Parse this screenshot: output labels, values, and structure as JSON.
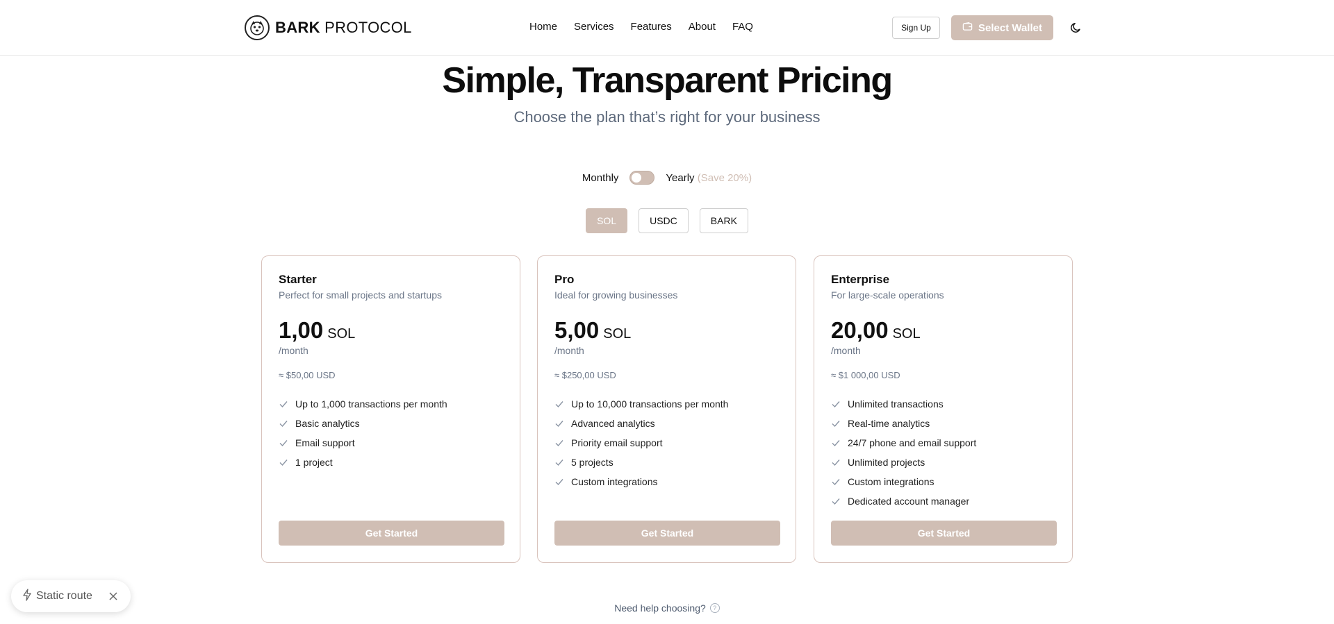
{
  "header": {
    "logo_bold": "BARK",
    "logo_rest": " PROTOCOL",
    "nav": [
      "Home",
      "Services",
      "Features",
      "About",
      "FAQ"
    ],
    "signup_label": "Sign Up",
    "wallet_label": "Select Wallet"
  },
  "hero": {
    "title": "Simple, Transparent Pricing",
    "subtitle": "Choose the plan that’s right for your business"
  },
  "billing": {
    "monthly_label": "Monthly",
    "yearly_label": "Yearly",
    "save_label": "(Save 20%)"
  },
  "currencies": [
    "SOL",
    "USDC",
    "BARK"
  ],
  "plans": [
    {
      "name": "Starter",
      "description": "Perfect for small projects and startups",
      "price": "1,00",
      "currency": "SOL",
      "period": "/month",
      "usd": "≈ $50,00 USD",
      "features": [
        "Up to 1,000 transactions per month",
        "Basic analytics",
        "Email support",
        "1 project"
      ],
      "cta": "Get Started"
    },
    {
      "name": "Pro",
      "description": "Ideal for growing businesses",
      "price": "5,00",
      "currency": "SOL",
      "period": "/month",
      "usd": "≈ $250,00 USD",
      "features": [
        "Up to 10,000 transactions per month",
        "Advanced analytics",
        "Priority email support",
        "5 projects",
        "Custom integrations"
      ],
      "cta": "Get Started"
    },
    {
      "name": "Enterprise",
      "description": "For large-scale operations",
      "price": "20,00",
      "currency": "SOL",
      "period": "/month",
      "usd": "≈ $1 000,00 USD",
      "features": [
        "Unlimited transactions",
        "Real-time analytics",
        "24/7 phone and email support",
        "Unlimited projects",
        "Custom integrations",
        "Dedicated account manager"
      ],
      "cta": "Get Started"
    }
  ],
  "help": {
    "label": "Need help choosing?",
    "icon_glyph": "?"
  },
  "static_route": {
    "label": "Static route"
  },
  "colors": {
    "accent": "#d0beb4",
    "muted_text": "#6a7587",
    "card_border": "#d9c3bc"
  },
  "icons": {
    "logo": "bark-dog-logo-icon",
    "wallet": "wallet-icon",
    "theme": "moon-icon",
    "check": "check-icon",
    "help": "question-circle-icon",
    "bolt": "lightning-bolt-icon",
    "close": "close-icon"
  }
}
